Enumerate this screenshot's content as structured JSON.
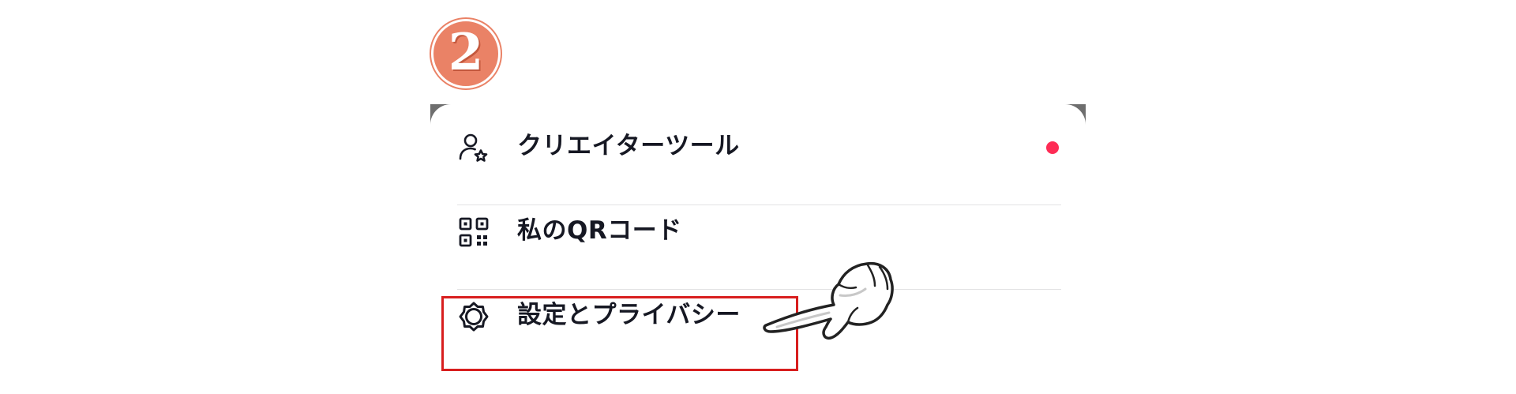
{
  "step_badge": {
    "number": "2",
    "color": "#ea8266"
  },
  "menu": {
    "items": [
      {
        "label": "クリエイターツール",
        "icon": "creator-tools-icon",
        "has_notification_dot": true
      },
      {
        "label": "私のQRコード",
        "icon": "qr-code-icon",
        "has_notification_dot": false
      },
      {
        "label": "設定とプライバシー",
        "icon": "gear-icon",
        "has_notification_dot": false,
        "highlighted": true
      }
    ]
  },
  "colors": {
    "text": "#161823",
    "notification_dot": "#fe2c55",
    "highlight_border": "#d81e1e",
    "divider": "#e3e3e4"
  },
  "annotations": {
    "pointer": "pointing-hand-icon"
  }
}
